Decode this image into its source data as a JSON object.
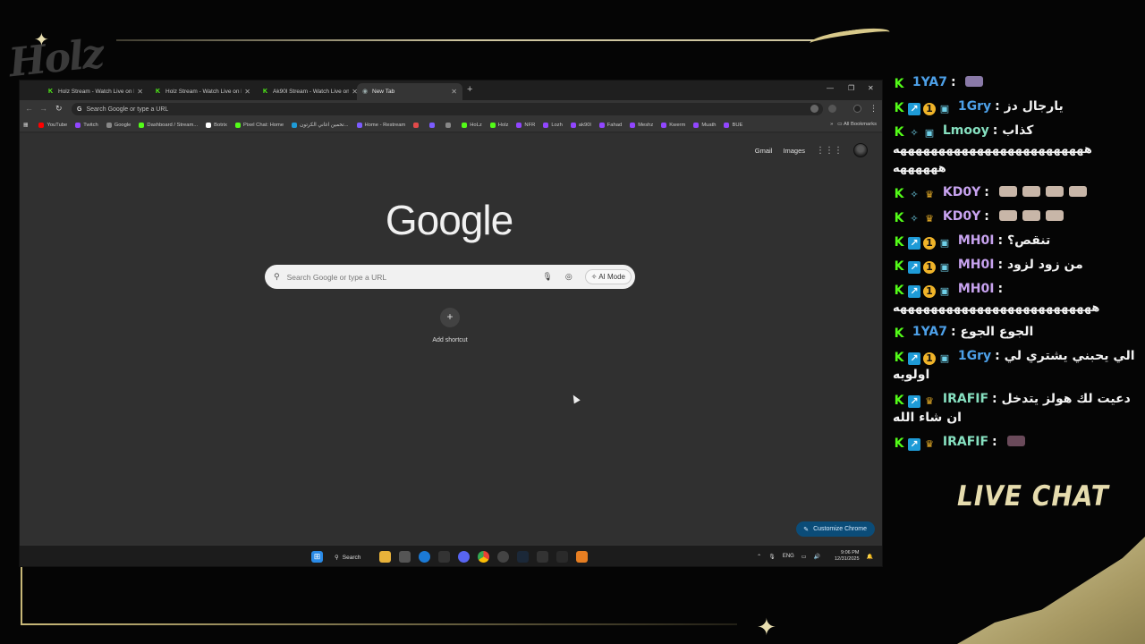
{
  "overlay": {
    "logo_text": "Holz",
    "live_chat_title": "LIVE CHAT"
  },
  "browser": {
    "tabs": [
      {
        "title": "Holz Stream - Watch Live on Ki",
        "icon": "kick-icon",
        "active": false
      },
      {
        "title": "Holz Stream - Watch Live on Ki",
        "icon": "kick-icon",
        "active": false
      },
      {
        "title": "Ak90l Stream - Watch Live on",
        "icon": "kick-icon",
        "active": false
      },
      {
        "title": "New Tab",
        "icon": "chrome-icon",
        "active": true
      }
    ],
    "address_bar_placeholder": "Search Google or type a URL",
    "bookmarks": [
      {
        "label": "YouTube",
        "color": "#ff0000"
      },
      {
        "label": "Twitch",
        "color": "#9146ff"
      },
      {
        "label": "Google",
        "color": "#888888"
      },
      {
        "label": "Dashboard / Stream...",
        "color": "#53fc18"
      },
      {
        "label": "Botrix",
        "color": "#ffffff"
      },
      {
        "label": "Pixel Chat: Home",
        "color": "#53fc18"
      },
      {
        "label": "تخمين اغاني الكرتون...",
        "color": "#1e9bd7"
      },
      {
        "label": "Home - Restream",
        "color": "#7c5cff"
      },
      {
        "label": "",
        "color": "#e24a4a"
      },
      {
        "label": "",
        "color": "#7c5cff"
      },
      {
        "label": "",
        "color": "#888888"
      },
      {
        "label": "HoLz",
        "color": "#53fc18"
      },
      {
        "label": "Holz",
        "color": "#53fc18"
      },
      {
        "label": "NFR",
        "color": "#9146ff"
      },
      {
        "label": "Lozh",
        "color": "#9146ff"
      },
      {
        "label": "ak90l",
        "color": "#9146ff"
      },
      {
        "label": "Fahad",
        "color": "#9146ff"
      },
      {
        "label": "Meshz",
        "color": "#9146ff"
      },
      {
        "label": "Kwerm",
        "color": "#9146ff"
      },
      {
        "label": "Muath",
        "color": "#9146ff"
      },
      {
        "label": "BUE",
        "color": "#9146ff"
      }
    ],
    "all_bookmarks_label": "All Bookmarks",
    "new_tab_page": {
      "gmail_label": "Gmail",
      "images_label": "Images",
      "logo_text": "Google",
      "search_placeholder": "Search Google or type a URL",
      "ai_mode_label": "AI Mode",
      "add_shortcut_label": "Add shortcut",
      "customize_label": "Customize Chrome"
    },
    "taskbar": {
      "search_label": "Search",
      "language": "ENG",
      "time": "9:06 PM",
      "date": "12/31/2025"
    }
  },
  "chat_messages": [
    {
      "user": "1YA7",
      "text": "",
      "badges": [
        "kick"
      ],
      "user_color": "#4da0e8",
      "emote": "purple"
    },
    {
      "user": "1Gry",
      "text": "يارجال دز",
      "badges": [
        "kick",
        "blue",
        "gold",
        "sub"
      ],
      "user_color": "#4da0e8",
      "emote": ""
    },
    {
      "user": "Lmooy",
      "text": "كذاب",
      "badges": [
        "kick",
        "sub",
        "sub"
      ],
      "user_color": "#86e0c0",
      "emote": ""
    },
    {
      "user": "",
      "text": "هههههههههههههههههههههههههه ههههههه",
      "badges": [],
      "user_color": "#f2f2f2",
      "emote": ""
    },
    {
      "user": "KD0Y",
      "text": "",
      "badges": [
        "kick",
        "sub",
        "crown"
      ],
      "user_color": "#c8a3f0",
      "emote": "x4"
    },
    {
      "user": "KD0Y",
      "text": "",
      "badges": [
        "kick",
        "sub",
        "crown"
      ],
      "user_color": "#c8a3f0",
      "emote": "x3"
    },
    {
      "user": "MH0I",
      "text": "تنقص؟",
      "badges": [
        "kick",
        "blue",
        "gold",
        "sub"
      ],
      "user_color": "#c8a3f0",
      "emote": ""
    },
    {
      "user": "MH0I",
      "text": "من زود لزود",
      "badges": [
        "kick",
        "blue",
        "gold",
        "sub"
      ],
      "user_color": "#c8a3f0",
      "emote": ""
    },
    {
      "user": "MH0I",
      "text": "ههههههههههههههههههههههههههه",
      "badges": [
        "kick",
        "blue",
        "gold",
        "sub"
      ],
      "user_color": "#c8a3f0",
      "emote": ""
    },
    {
      "user": "1YA7",
      "text": "الجوع الجوع",
      "badges": [
        "kick"
      ],
      "user_color": "#4da0e8",
      "emote": ""
    },
    {
      "user": "1Gry",
      "text": "الي يحبني يشتري لي اولويه",
      "badges": [
        "kick",
        "blue",
        "gold",
        "sub"
      ],
      "user_color": "#4da0e8",
      "emote": ""
    },
    {
      "user": "IRAFIF",
      "text": "دعيت لك هولز يتدخل ان شاء الله",
      "badges": [
        "kick",
        "blue",
        "crown"
      ],
      "user_color": "#86e0c0",
      "emote": ""
    },
    {
      "user": "IRAFIF",
      "text": "",
      "badges": [
        "kick",
        "blue",
        "crown"
      ],
      "user_color": "#86e0c0",
      "emote": "dark"
    }
  ]
}
